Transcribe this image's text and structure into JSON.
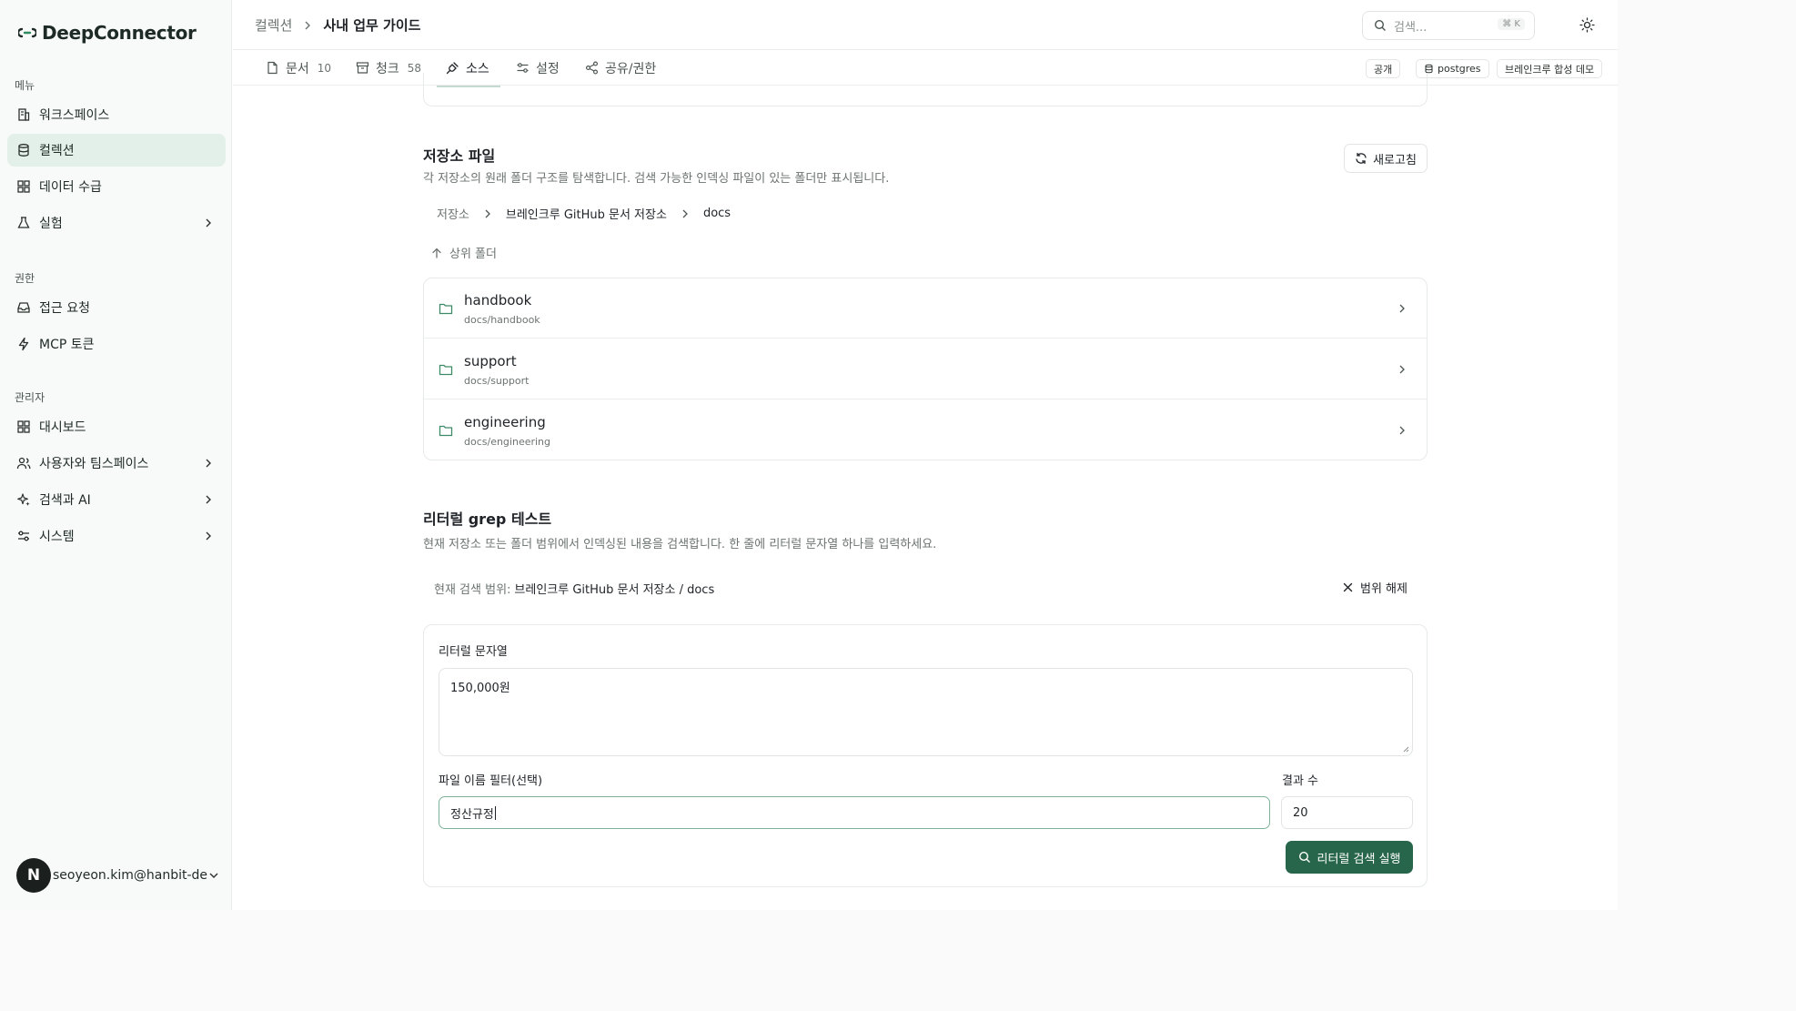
{
  "app": {
    "name": "DeepConnector"
  },
  "sidebar": {
    "sections": [
      {
        "title": "메뉴",
        "items": [
          {
            "label": "워크스페이스",
            "icon": "building-icon",
            "active": false,
            "chevron": false
          },
          {
            "label": "컬렉션",
            "icon": "database-icon",
            "active": true,
            "chevron": false
          },
          {
            "label": "데이터 수급",
            "icon": "grid-icon",
            "active": false,
            "chevron": false
          },
          {
            "label": "실험",
            "icon": "flask-icon",
            "active": false,
            "chevron": true
          }
        ]
      },
      {
        "title": "권한",
        "items": [
          {
            "label": "접근 요청",
            "icon": "inbox-icon",
            "active": false,
            "chevron": false
          },
          {
            "label": "MCP 토큰",
            "icon": "bolt-icon",
            "active": false,
            "chevron": false
          }
        ]
      },
      {
        "title": "관리자",
        "items": [
          {
            "label": "대시보드",
            "icon": "grid-icon",
            "active": false,
            "chevron": false
          },
          {
            "label": "사용자와 팀스페이스",
            "icon": "users-icon",
            "active": false,
            "chevron": true
          },
          {
            "label": "검색과 AI",
            "icon": "sparkle-icon",
            "active": false,
            "chevron": true
          },
          {
            "label": "시스템",
            "icon": "sliders-icon",
            "active": false,
            "chevron": true
          }
        ]
      }
    ],
    "user": {
      "initial": "N",
      "email": "seoyeon.kim@hanbit-de..."
    }
  },
  "header": {
    "breadcrumb": [
      "컬렉션",
      "사내 업무 가이드"
    ],
    "search": {
      "placeholder": "검색...",
      "shortcut": "⌘ K"
    }
  },
  "tabs": [
    {
      "label": "문서",
      "count": "10",
      "icon": "file-icon",
      "active": false
    },
    {
      "label": "청크",
      "count": "58",
      "icon": "archive-icon",
      "active": false
    },
    {
      "label": "소스",
      "count": "",
      "icon": "plug-icon",
      "active": true
    },
    {
      "label": "설정",
      "count": "",
      "icon": "sliders-icon",
      "active": false
    },
    {
      "label": "공유/권한",
      "count": "",
      "icon": "share-icon",
      "active": false
    }
  ],
  "chips": [
    {
      "label": "공개",
      "icon": ""
    },
    {
      "label": "postgres",
      "icon": "database-icon"
    },
    {
      "label": "브레인크루 합성 데모",
      "icon": ""
    }
  ],
  "repo_files": {
    "title": "저장소 파일",
    "description": "각 저장소의 원래 폴더 구조를 탐색합니다. 검색 가능한 인덱싱 파일이 있는 폴더만 표시됩니다.",
    "refresh_label": "새로고침",
    "path": [
      "저장소",
      "브레인크루 GitHub 문서 저장소",
      "docs"
    ],
    "up_label": "상위 폴더",
    "folders": [
      {
        "name": "handbook",
        "path": "docs/handbook"
      },
      {
        "name": "support",
        "path": "docs/support"
      },
      {
        "name": "engineering",
        "path": "docs/engineering"
      }
    ]
  },
  "grep_test": {
    "title": "리터럴 grep 테스트",
    "description": "현재 저장소 또는 폴더 범위에서 인덱싱된 내용을 검색합니다. 한 줄에 리터럴 문자열 하나를 입력하세요.",
    "scope_label": "현재 검색 범위:",
    "scope_value": "브레인크루 GitHub 문서 저장소 / docs",
    "clear_scope_label": "범위 해제",
    "literal_label": "리터럴 문자열",
    "literal_value": "150,000원",
    "filename_label": "파일 이름 필터(선택)",
    "filename_value": "정산규정",
    "count_label": "결과 수",
    "count_value": "20",
    "run_label": "리터럴 검색 실행"
  },
  "colors": {
    "accent": "#27664a",
    "active_nav": "#e3efe9",
    "focus_ring": "#7eb39a"
  }
}
